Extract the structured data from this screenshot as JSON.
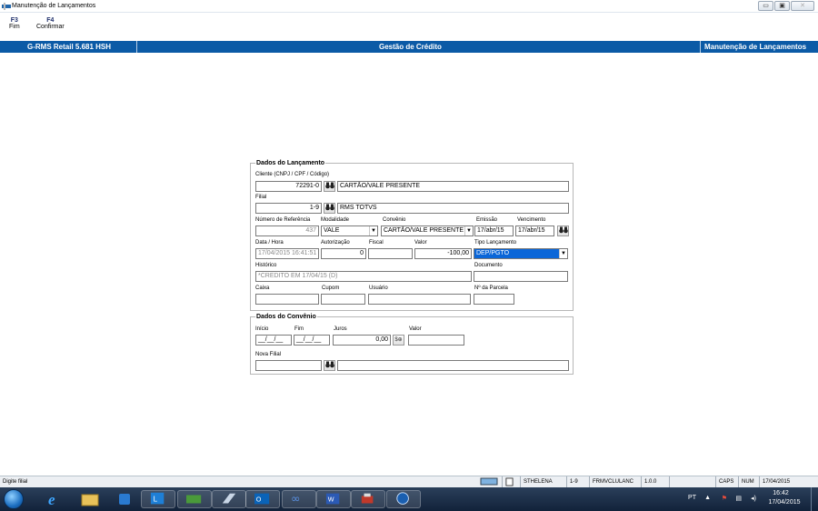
{
  "window": {
    "title": "Manutenção de Lançamentos",
    "minimize_icon": "minimize-icon",
    "restore_icon": "restore-icon",
    "close_icon": "close-icon"
  },
  "toolbar": [
    {
      "key": "F3",
      "label": "Fim"
    },
    {
      "key": "F4",
      "label": "Confirmar"
    }
  ],
  "header": {
    "app": "G-RMS Retail 5.681 HSH",
    "module": "Gestão de Crédito",
    "screen": "Manutenção de Lançamentos"
  },
  "lancamento": {
    "title": "Dados do Lançamento",
    "cliente_label": "Cliente (CNPJ / CPF / Código)",
    "cliente_value": "72291-0",
    "cliente_nome": "CARTÃO/VALE PRESENTE",
    "filial_label": "Filial",
    "filial_value": "1-9",
    "filial_nome": "RMS TOTVS",
    "num_ref_label": "Número de Referência",
    "num_ref_value": "437",
    "modalidade_label": "Modalidade",
    "modalidade_value": "VALE",
    "convenio_label": "Convênio",
    "convenio_value": "CARTÃO/VALE PRESENTE",
    "emissao_label": "Emissão",
    "emissao_value": "17/abr/15",
    "vencimento_label": "Vencimento",
    "vencimento_value": "17/abr/15",
    "data_hora_label": "Data / Hora",
    "data_hora_value": "17/04/2015 16:41:51",
    "autorizacao_label": "Autorização",
    "autorizacao_value": "0",
    "fiscal_label": "Fiscal",
    "fiscal_value": "",
    "valor_label": "Valor",
    "valor_value": "-100,00",
    "tipo_label": "Tipo Lançamento",
    "tipo_value": "DEP/PGTO",
    "historico_label": "Histórico",
    "historico_value": "*CREDITO EM 17/04/15 (D)",
    "documento_label": "Documento",
    "documento_value": "",
    "caixa_label": "Caixa",
    "cupom_label": "Cupom",
    "usuario_label": "Usuário",
    "parcela_label": "Nº da Parcela"
  },
  "convenio": {
    "title": "Dados do Convênio",
    "inicio_label": "Início",
    "inicio_value": "__/__/__",
    "fim_label": "Fim",
    "fim_value": "__/__/__",
    "juros_label": "Juros",
    "juros_value": "0,00",
    "valor_label": "Valor",
    "valor_value": "",
    "nova_filial_label": "Nova Filial",
    "nova_filial_value": ""
  },
  "status": {
    "message": "Digite filial",
    "user": "STHELENA",
    "filial": "1-9",
    "form": "FRMVCLULANC",
    "version": "1.0.0",
    "caps": "CAPS",
    "num": "NUM",
    "date": "17/04/2015"
  },
  "tray": {
    "lang": "PT",
    "time": "16:42",
    "date": "17/04/2015"
  },
  "taskbar_icons": [
    "ie-icon",
    "explorer-icon",
    "media-icon",
    "lync-icon",
    "money-icon",
    "window-icon",
    "outlook-icon",
    "infinity-icon",
    "word-icon",
    "tools-icon",
    "app-icon"
  ]
}
